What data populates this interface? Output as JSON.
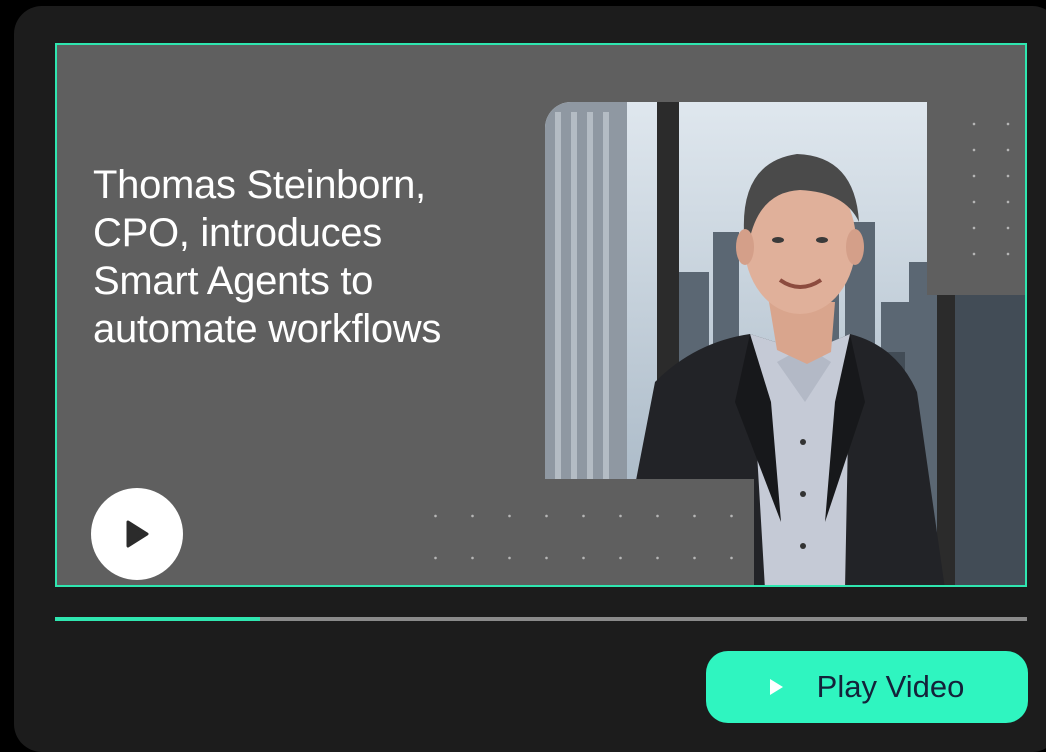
{
  "video": {
    "headline_lines": [
      "Thomas Steinborn,",
      "CPO, introduces",
      "Smart Agents to",
      "automate workflows"
    ],
    "progress_fraction": 0.211,
    "play_icon": "play-icon"
  },
  "controls": {
    "play_button_label": "Play Video",
    "play_button_icon": "play-triangle-icon"
  },
  "colors": {
    "accent": "#2fe6b0",
    "button": "#2ff5c0",
    "button_text": "#14223a",
    "panel": "#5f5f5f",
    "card": "#1c1c1c"
  }
}
